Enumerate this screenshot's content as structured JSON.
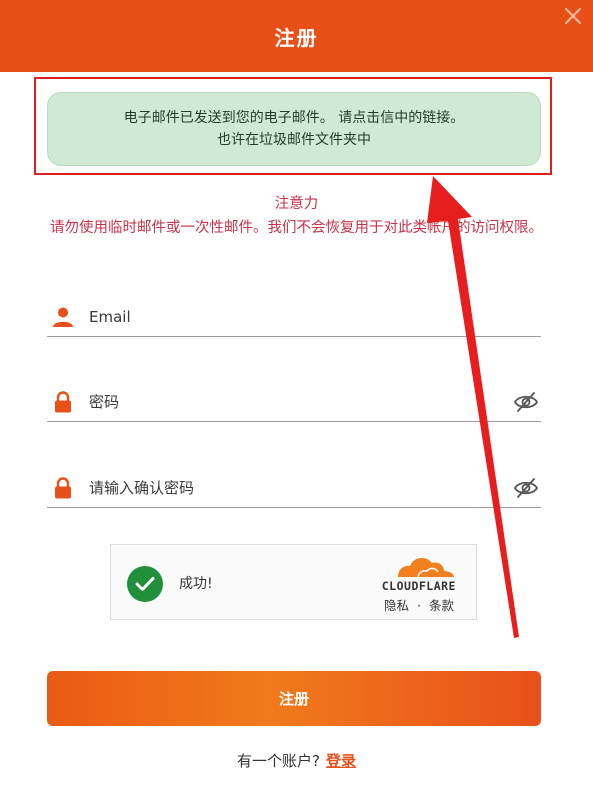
{
  "header": {
    "title": "注册",
    "close_icon": "close-icon"
  },
  "notice": {
    "line1": "电子邮件已发送到您的电子邮件。 请点击信中的链接。",
    "line2": "也许在垃圾邮件文件夹中"
  },
  "warning": {
    "title": "注意力",
    "body": "请勿使用临时邮件或一次性邮件。我们不会恢复用于对此类帐户的访问权限。"
  },
  "form": {
    "email_placeholder": "Email",
    "password_placeholder": "密码",
    "confirm_placeholder": "请输入确认密码"
  },
  "captcha": {
    "status": "成功!",
    "brand": "CLOUDFLARE",
    "privacy": "隐私",
    "separator": "·",
    "terms": "条款"
  },
  "submit_label": "注册",
  "footer": {
    "prompt": "有一个账户?",
    "login_link": "登录"
  },
  "colors": {
    "brand": "#e8501a",
    "success_bg": "#cfe9d4",
    "warning_text": "#c8324a",
    "annotation_red": "#e02020",
    "captcha_green": "#1f8f3a"
  },
  "icons": [
    "close-icon",
    "user-icon",
    "lock-icon",
    "eye-off-icon",
    "check-icon",
    "cloudflare-cloud-icon"
  ]
}
